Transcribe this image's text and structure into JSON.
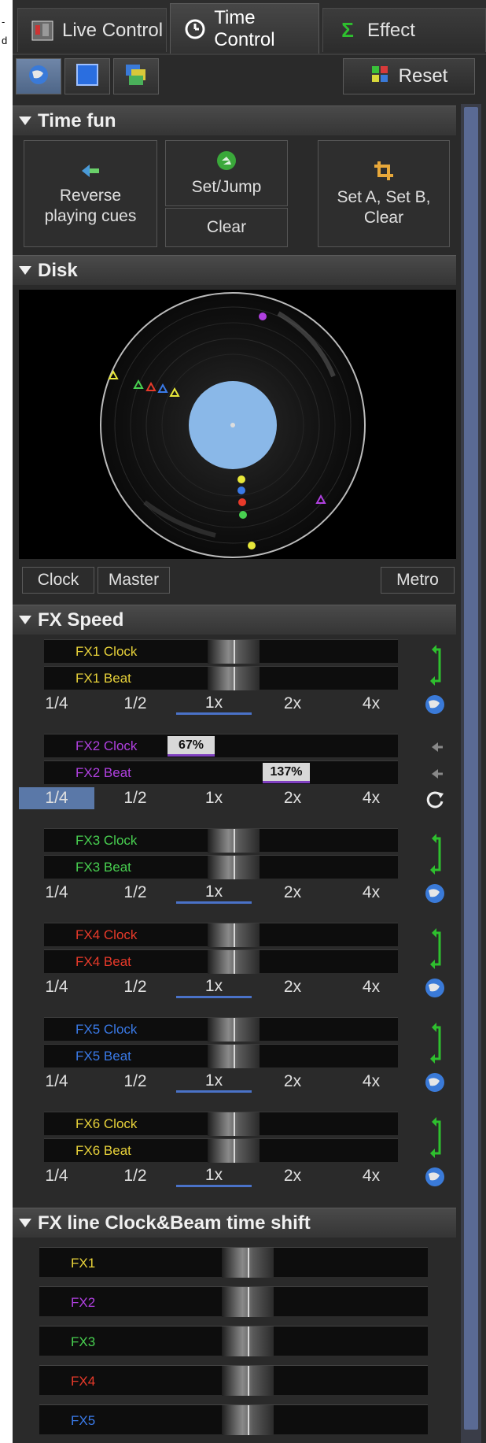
{
  "clip_text": {
    "line1": "-",
    "line2": "d"
  },
  "tabs": [
    {
      "label": "Live Control"
    },
    {
      "label": "Time Control"
    },
    {
      "label": "Effect"
    }
  ],
  "toolbar": {
    "reset_label": "Reset"
  },
  "sections": {
    "time_fun": "Time fun",
    "disk": "Disk",
    "fx_speed": "FX Speed",
    "fx_line": "FX line Clock&Beam time shift"
  },
  "time_fun": {
    "reverse": "Reverse\nplaying cues",
    "setjump": "Set/Jump",
    "clear": "Clear",
    "setab": "Set A, Set B,\nClear"
  },
  "disk_buttons": {
    "clock": "Clock",
    "master": "Master",
    "metro": "Metro"
  },
  "ratios": [
    "1/4",
    "1/2",
    "1x",
    "2x",
    "4x"
  ],
  "fx_groups": [
    {
      "clock": "FX1 Clock",
      "beat": "FX1 Beat",
      "color": "#e8d23a",
      "selected_ratio": "1x"
    },
    {
      "clock": "FX2 Clock",
      "beat": "FX2 Beat",
      "color": "#b040e0",
      "clock_pct": "67%",
      "beat_pct": "137%",
      "selected_ratio": "1/4"
    },
    {
      "clock": "FX3 Clock",
      "beat": "FX3 Beat",
      "color": "#48d050",
      "selected_ratio": "1x"
    },
    {
      "clock": "FX4 Clock",
      "beat": "FX4 Beat",
      "color": "#e83a2a",
      "selected_ratio": "1x"
    },
    {
      "clock": "FX5 Clock",
      "beat": "FX5 Beat",
      "color": "#3a7ae8",
      "selected_ratio": "1x"
    },
    {
      "clock": "FX6 Clock",
      "beat": "FX6 Beat",
      "color": "#e8d23a",
      "selected_ratio": "1x"
    }
  ],
  "fx_lines": [
    {
      "label": "FX1",
      "color": "#e8d23a"
    },
    {
      "label": "FX2",
      "color": "#b040e0"
    },
    {
      "label": "FX3",
      "color": "#48d050"
    },
    {
      "label": "FX4",
      "color": "#e83a2a"
    },
    {
      "label": "FX5",
      "color": "#3a7ae8"
    }
  ],
  "colors": {
    "accent": "#4a72c8",
    "panel": "#2a2a2a"
  }
}
